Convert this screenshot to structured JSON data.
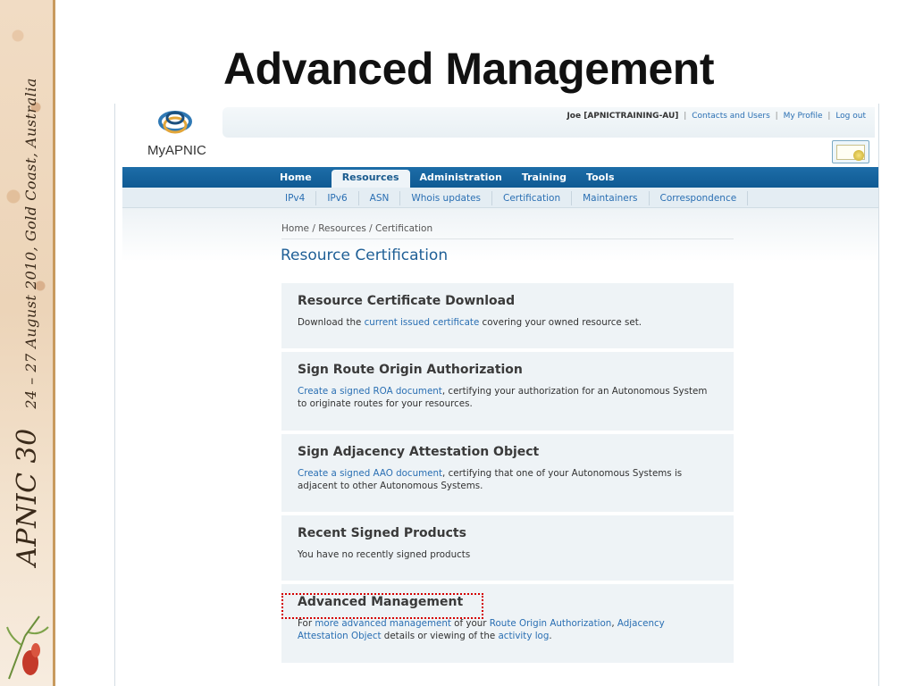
{
  "slide": {
    "title": "Advanced Management",
    "side_event_name": "APNIC 30",
    "side_event_details": "24 – 27 August 2010, Gold Coast, Australia"
  },
  "app": {
    "logo_text": "MyAPNIC",
    "user": "Joe [APNICTRAINING-AU]",
    "top_links": [
      "Contacts and Users",
      "My Profile",
      "Log out"
    ]
  },
  "nav": {
    "tabs": [
      {
        "label": "Home",
        "active": false
      },
      {
        "label": "Resources",
        "active": true
      },
      {
        "label": "Administration",
        "active": false
      },
      {
        "label": "Training",
        "active": false
      },
      {
        "label": "Tools",
        "active": false
      }
    ],
    "sub_items": [
      "IPv4",
      "IPv6",
      "ASN",
      "Whois updates",
      "Certification",
      "Maintainers",
      "Correspondence"
    ]
  },
  "breadcrumb": "Home / Resources / Certification",
  "page_title": "Resource Certification",
  "panels": [
    {
      "title": "Resource Certificate Download",
      "before": "Download the ",
      "link": "current issued certificate",
      "after": " covering your owned resource set."
    },
    {
      "title": "Sign Route Origin Authorization",
      "before": "",
      "link": "Create a signed ROA document",
      "after": ", certifying your authorization for an Autonomous System to originate routes for your resources."
    },
    {
      "title": "Sign Adjacency Attestation Object",
      "before": "",
      "link": "Create a signed AAO document",
      "after": ", certifying that one of your Autonomous Systems is adjacent to other Autonomous Systems."
    },
    {
      "title": "Recent Signed Products",
      "text": "You have no recently signed products"
    },
    {
      "title": "Advanced Management",
      "before": "For ",
      "link1": "more advanced management",
      "mid1": " of your ",
      "link2": "Route Origin Authorization",
      "mid2": ", ",
      "link3": "Adjacency Attestation Object",
      "mid3": " details or viewing of the ",
      "link4": "activity log",
      "after": "."
    }
  ],
  "colors": {
    "nav_blue": "#1d6da8",
    "link_blue": "#2a6fb3",
    "panel_bg": "#eef3f6",
    "highlight_red": "#d40000"
  }
}
